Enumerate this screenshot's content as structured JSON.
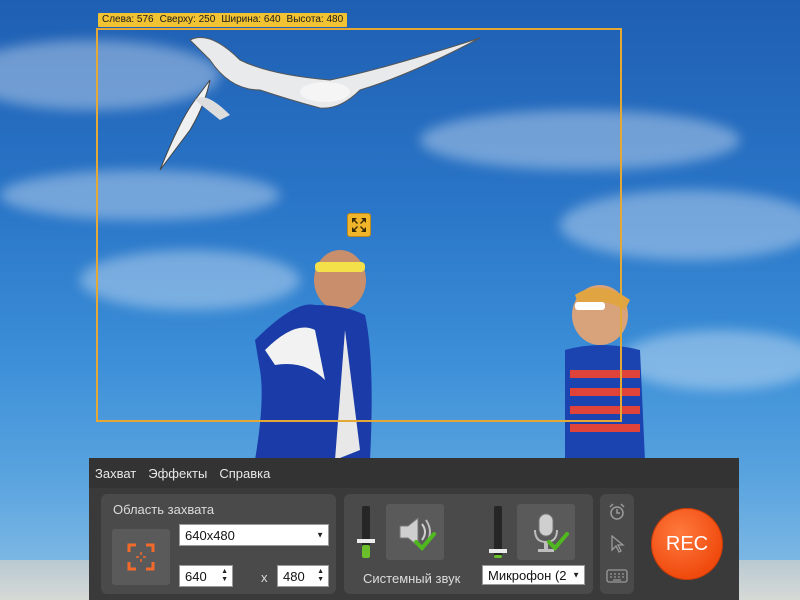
{
  "overlay": {
    "left_label": "Слева: 576",
    "top_label": "Сверху: 250",
    "width_label": "Ширина: 640",
    "height_label": "Высота: 480"
  },
  "menu": [
    "Захват",
    "Эффекты",
    "Справка"
  ],
  "capture": {
    "title": "Область захвата",
    "preset": "640x480",
    "width": "640",
    "height": "480",
    "x_separator": "x"
  },
  "audio": {
    "system_label": "Системный звук",
    "system_level": 0.25,
    "mic_select": "Микрофон (2",
    "mic_level": 0.05
  },
  "rec_label": "REC",
  "colors": {
    "frame": "#e3a835",
    "rec": "#f04a0e",
    "level": "#6bbf2a"
  },
  "icons": [
    "expand-arrows-icon",
    "capture-area-icon",
    "speaker-icon",
    "microphone-icon",
    "checkmark-icon",
    "alarm-clock-icon",
    "cursor-icon",
    "keyboard-icon"
  ]
}
